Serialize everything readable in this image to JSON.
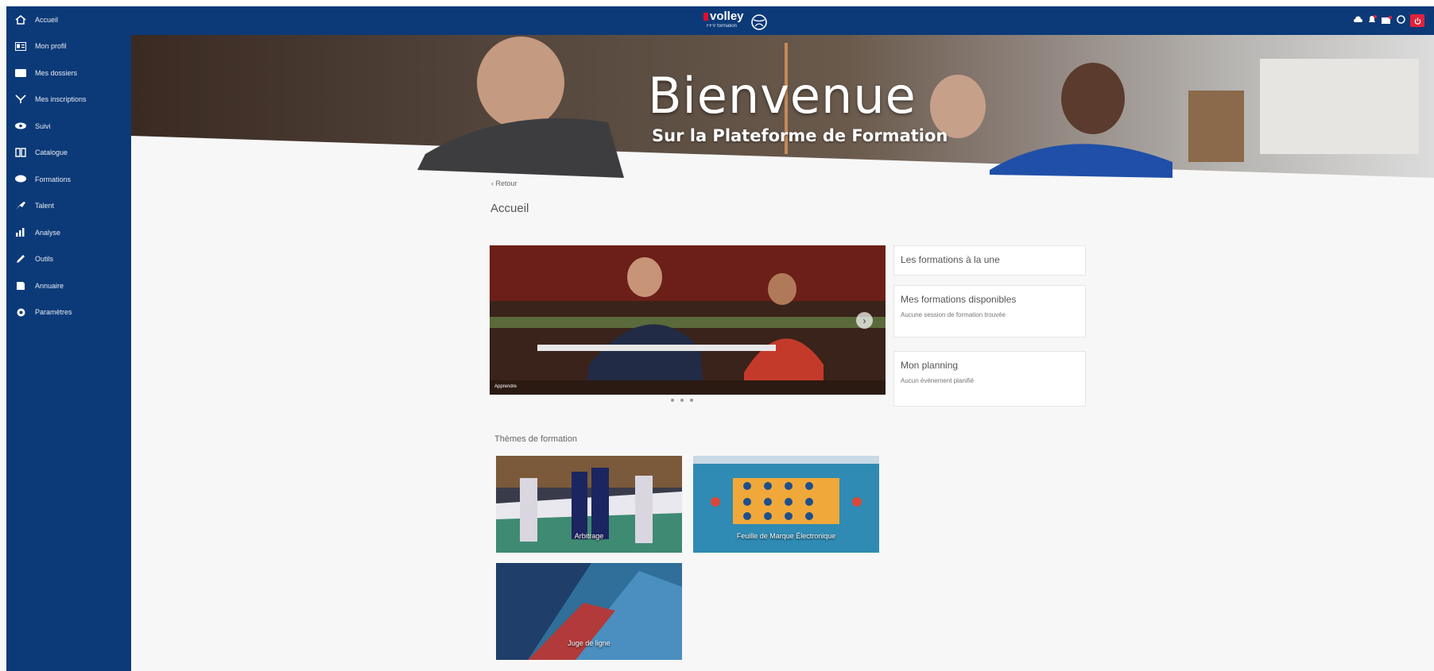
{
  "sidebar": {
    "items": [
      {
        "label": "Accueil",
        "icon": "home-icon"
      },
      {
        "label": "Mon profil",
        "icon": "profile-icon"
      },
      {
        "label": "Mes dossiers",
        "icon": "folder-icon"
      },
      {
        "label": "Mes inscriptions",
        "icon": "graduation-icon"
      },
      {
        "label": "Suivi",
        "icon": "eye-icon"
      },
      {
        "label": "Catalogue",
        "icon": "book-icon"
      },
      {
        "label": "Formations",
        "icon": "chat-icon"
      },
      {
        "label": "Talent",
        "icon": "brush-icon"
      },
      {
        "label": "Analyse",
        "icon": "chart-icon"
      },
      {
        "label": "Outils",
        "icon": "pencil-icon"
      },
      {
        "label": "Annuaire",
        "icon": "directory-icon"
      },
      {
        "label": "Paramètres",
        "icon": "gear-icon"
      }
    ]
  },
  "header": {
    "logo_text": "volley",
    "logo_sub": "FFV formation",
    "icons": [
      "cloud-icon",
      "notification-icon",
      "mail-icon",
      "help-icon",
      "power-icon"
    ],
    "brand_color": "#0c3a78",
    "accent_color": "#e3213a"
  },
  "banner": {
    "title": "Bienvenue",
    "subtitle": "Sur la Plateforme de Formation"
  },
  "main": {
    "back_label": "Retour",
    "page_title": "Accueil",
    "carousel": {
      "caption": "Apprendre",
      "slides": 3
    },
    "cards": [
      {
        "title": "Les formations à la une",
        "body": ""
      },
      {
        "title": "Mes formations disponibles",
        "body": "Aucune session de formation trouvée"
      },
      {
        "title": "Mon planning",
        "body": "Aucun événement planifié"
      }
    ],
    "themes_title": "Thèmes de formation",
    "themes": [
      {
        "label": "Arbitrage"
      },
      {
        "label": "Feuille de Marque Électronique"
      },
      {
        "label": "Juge de ligne"
      }
    ]
  }
}
